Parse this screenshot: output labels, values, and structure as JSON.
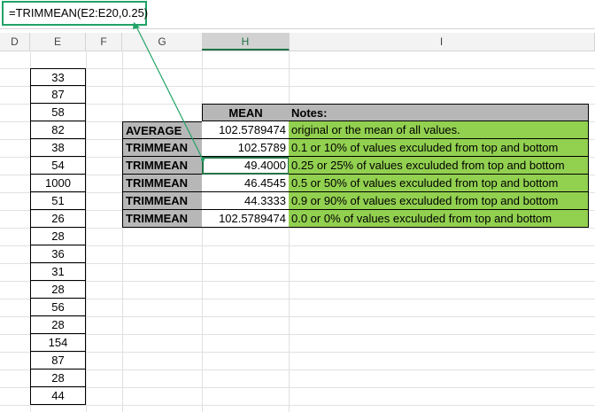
{
  "formula_bar": {
    "formula": "=TRIMMEAN(E2:E20,0.25)"
  },
  "columns": [
    "D",
    "E",
    "F",
    "G",
    "H",
    "I"
  ],
  "column_e_values": [
    "33",
    "87",
    "58",
    "82",
    "38",
    "54",
    "1000",
    "51",
    "26",
    "28",
    "36",
    "31",
    "28",
    "56",
    "28",
    "154",
    "87",
    "28",
    "44"
  ],
  "table": {
    "header_mean": "MEAN",
    "header_notes": "Notes:",
    "rows": [
      {
        "label": "AVERAGE",
        "value": "102.5789474",
        "note": "original or the mean of all values."
      },
      {
        "label": "TRIMMEAN",
        "value": "102.5789",
        "note": "0.1 or 10% of values exculuded from top and bottom"
      },
      {
        "label": "TRIMMEAN",
        "value": "49.4000",
        "note": "0.25 or 25% of values exculuded from top and bottom"
      },
      {
        "label": "TRIMMEAN",
        "value": "46.4545",
        "note": "0.5 or 50% of values exculuded from top and bottom"
      },
      {
        "label": "TRIMMEAN",
        "value": "44.3333",
        "note": "0.9 or 90% of values exculuded from top and bottom"
      },
      {
        "label": "TRIMMEAN",
        "value": "102.5789474",
        "note": "0.0 or 0% of values exculuded from top and bottom"
      }
    ]
  },
  "colors": {
    "accent_green": "#21a366",
    "note_green": "#92d050",
    "label_gray": "#b7b7b7"
  }
}
